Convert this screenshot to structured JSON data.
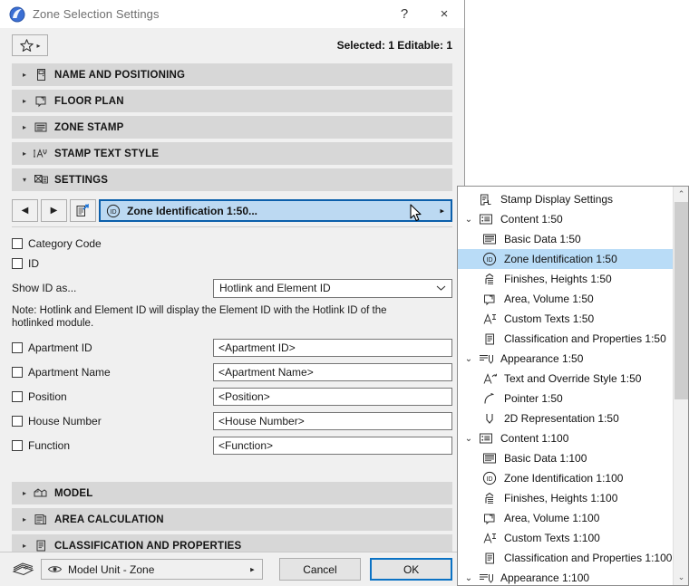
{
  "window": {
    "title": "Zone Selection Settings",
    "icon": "zone-app-icon",
    "help_label": "?",
    "close_label": "×"
  },
  "subbar": {
    "favorites_icon": "star-icon",
    "favorites_arrow": "▸",
    "selection_info": "Selected: 1 Editable: 1"
  },
  "sections": [
    {
      "label": "NAME AND POSITIONING",
      "icon": "name-positioning-icon",
      "expanded": false,
      "arrow": "▸"
    },
    {
      "label": "FLOOR PLAN",
      "icon": "floor-plan-icon",
      "expanded": false,
      "arrow": "▸"
    },
    {
      "label": "ZONE STAMP",
      "icon": "zone-stamp-icon",
      "expanded": false,
      "arrow": "▸"
    },
    {
      "label": "STAMP TEXT STYLE",
      "icon": "stamp-text-style-icon",
      "expanded": false,
      "arrow": "▸"
    },
    {
      "label": "SETTINGS",
      "icon": "settings-icon",
      "expanded": true,
      "arrow": "▾"
    }
  ],
  "bottom_sections": [
    {
      "label": "MODEL",
      "icon": "model-icon",
      "arrow": "▸"
    },
    {
      "label": "AREA CALCULATION",
      "icon": "area-calculation-icon",
      "arrow": "▸"
    },
    {
      "label": "CLASSIFICATION AND PROPERTIES",
      "icon": "classification-properties-icon",
      "arrow": "▸"
    }
  ],
  "settings": {
    "nav": {
      "prev_icon": "◀",
      "next_icon": "▶",
      "edit_icon": "edit-scheme-icon"
    },
    "current_scheme": {
      "icon": "zone-identification-id-icon",
      "label": "Zone Identification 1:50...",
      "arrow": "▸"
    },
    "checkboxes": [
      {
        "label": "Category Code",
        "checked": false
      },
      {
        "label": "ID",
        "checked": false
      }
    ],
    "show_id": {
      "label": "Show ID as...",
      "value": "Hotlink and Element ID",
      "arrow": "⌄",
      "options": [
        "Hotlink and Element ID"
      ]
    },
    "note": "Note: Hotlink and Element ID will display the Element ID with the Hotlink ID of the hotlinked module.",
    "fields": [
      {
        "label": "Apartment ID",
        "checked": false,
        "value": "<Apartment ID>"
      },
      {
        "label": "Apartment Name",
        "checked": false,
        "value": "<Apartment Name>"
      },
      {
        "label": "Position",
        "checked": false,
        "value": "<Position>"
      },
      {
        "label": "House Number",
        "checked": false,
        "value": "<House Number>"
      },
      {
        "label": "Function",
        "checked": false,
        "value": "<Function>"
      }
    ]
  },
  "footer": {
    "layer_icon": "layers-icon",
    "unit": {
      "icon": "eye-icon",
      "label": "Model Unit - Zone",
      "arrow": "▸"
    },
    "cancel_label": "Cancel",
    "ok_label": "OK"
  },
  "tree": {
    "scroll_up": "⌃",
    "scroll_down": "⌄",
    "items": [
      {
        "label": "Stamp Display Settings",
        "icon": "stamp-display-settings-icon",
        "indent": 1,
        "twisty": "",
        "selected": false
      },
      {
        "label": "Content 1:50",
        "icon": "content-list-icon",
        "indent": 0,
        "twisty": "⌄",
        "selected": false
      },
      {
        "label": "Basic Data 1:50",
        "icon": "basic-data-icon",
        "indent": 2,
        "twisty": "",
        "selected": false
      },
      {
        "label": "Zone Identification 1:50",
        "icon": "zone-identification-id-icon",
        "indent": 2,
        "twisty": "",
        "selected": true
      },
      {
        "label": "Finishes, Heights 1:50",
        "icon": "finishes-heights-icon",
        "indent": 2,
        "twisty": "",
        "selected": false
      },
      {
        "label": "Area, Volume 1:50",
        "icon": "area-volume-icon",
        "indent": 2,
        "twisty": "",
        "selected": false
      },
      {
        "label": "Custom Texts 1:50",
        "icon": "custom-texts-icon",
        "indent": 2,
        "twisty": "",
        "selected": false
      },
      {
        "label": "Classification and Properties 1:50",
        "icon": "classification-properties-icon",
        "indent": 2,
        "twisty": "",
        "selected": false
      },
      {
        "label": "Appearance 1:50",
        "icon": "appearance-icon",
        "indent": 0,
        "twisty": "⌄",
        "selected": false
      },
      {
        "label": "Text and Override Style 1:50",
        "icon": "text-override-style-icon",
        "indent": 2,
        "twisty": "",
        "selected": false
      },
      {
        "label": "Pointer 1:50",
        "icon": "pointer-icon",
        "indent": 2,
        "twisty": "",
        "selected": false
      },
      {
        "label": "2D Representation 1:50",
        "icon": "2d-representation-icon",
        "indent": 2,
        "twisty": "",
        "selected": false
      },
      {
        "label": "Content 1:100",
        "icon": "content-list-icon",
        "indent": 0,
        "twisty": "⌄",
        "selected": false
      },
      {
        "label": "Basic Data 1:100",
        "icon": "basic-data-icon",
        "indent": 2,
        "twisty": "",
        "selected": false
      },
      {
        "label": "Zone Identification 1:100",
        "icon": "zone-identification-id-icon",
        "indent": 2,
        "twisty": "",
        "selected": false
      },
      {
        "label": "Finishes, Heights 1:100",
        "icon": "finishes-heights-icon",
        "indent": 2,
        "twisty": "",
        "selected": false
      },
      {
        "label": "Area, Volume 1:100",
        "icon": "area-volume-icon",
        "indent": 2,
        "twisty": "",
        "selected": false
      },
      {
        "label": "Custom Texts 1:100",
        "icon": "custom-texts-icon",
        "indent": 2,
        "twisty": "",
        "selected": false
      },
      {
        "label": "Classification and Properties 1:100",
        "icon": "classification-properties-icon",
        "indent": 2,
        "twisty": "",
        "selected": false
      },
      {
        "label": "Appearance 1:100",
        "icon": "appearance-icon",
        "indent": 0,
        "twisty": "⌄",
        "selected": false
      }
    ]
  },
  "colors": {
    "accent": "#0b72c4",
    "selection": "#b9dcf7",
    "dialog_bg": "#f0f0f0",
    "section_bg": "#d7d7d7"
  }
}
